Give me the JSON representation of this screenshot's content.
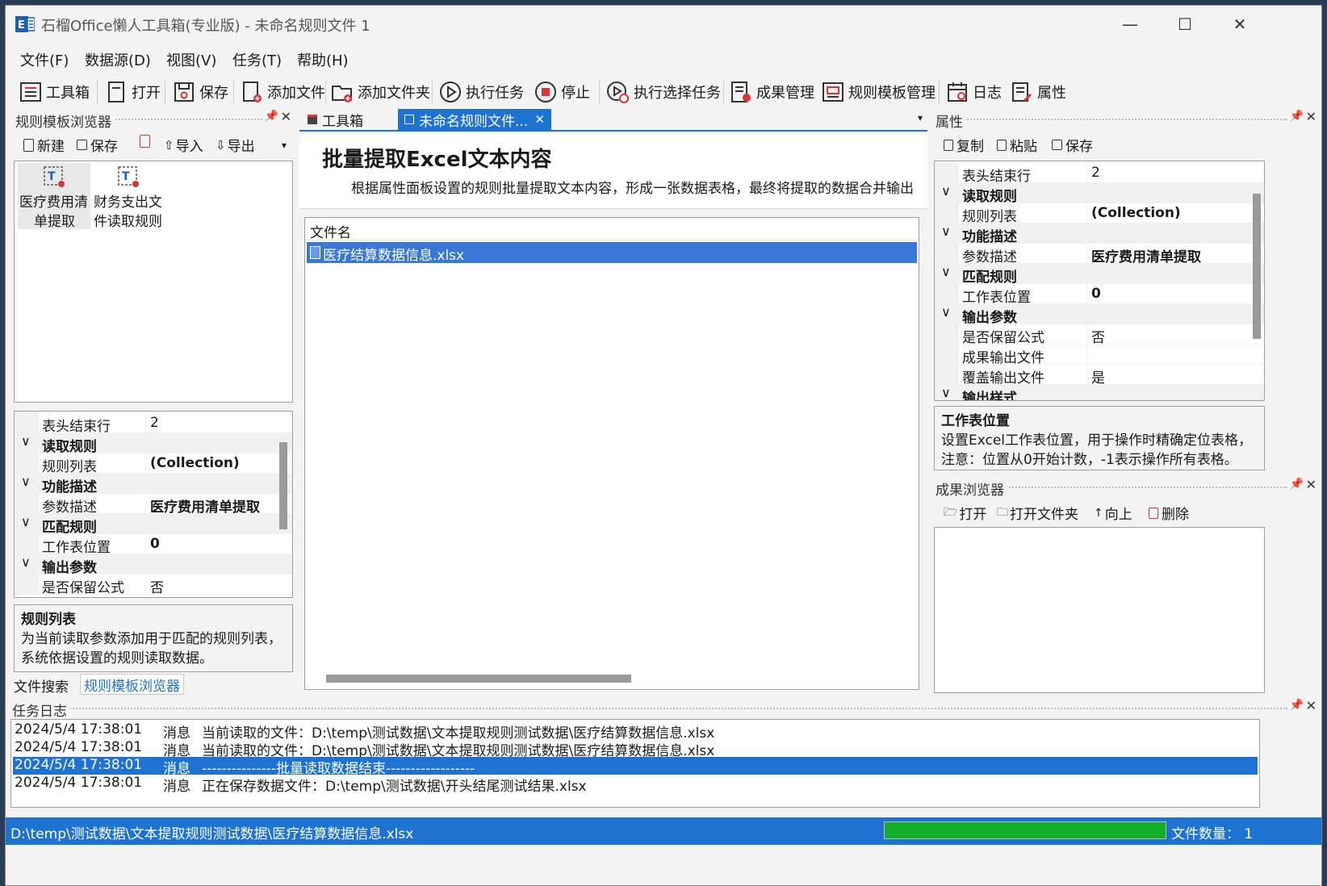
{
  "window": {
    "title": "石榴Office懒人工具箱(专业版) - 未命名规则文件 1",
    "minimize_glyph": "—",
    "maximize_glyph": "☐",
    "close_glyph": "✕"
  },
  "menu": [
    "文件(F)",
    "数据源(D)",
    "视图(V)",
    "任务(T)",
    "帮助(H)"
  ],
  "toolbar": {
    "toolbox": "工具箱",
    "open": "打开",
    "save": "保存",
    "add_file": "添加文件",
    "add_folder": "添加文件夹",
    "run_task": "执行任务",
    "stop": "停止",
    "run_selected": "执行选择任务",
    "results": "成果管理",
    "templates": "规则模板管理",
    "log": "日志",
    "properties": "属性"
  },
  "left_panel": {
    "title": "规则模板浏览器",
    "tools": {
      "new": "新建",
      "save": "保存",
      "import": "导入",
      "export": "导出"
    },
    "templates": [
      {
        "line1": "医疗费用清",
        "line2": "单提取"
      },
      {
        "line1": "财务支出文",
        "line2": "件读取规则"
      }
    ],
    "props": {
      "header_end_row_label": "表头结束行",
      "header_end_row_value": "2",
      "cat_read_rules": "读取规则",
      "rule_list_label": "规则列表",
      "rule_list_value": "(Collection)",
      "cat_func_desc": "功能描述",
      "param_desc_label": "参数描述",
      "param_desc_value": "医疗费用清单提取",
      "cat_match_rules": "匹配规则",
      "sheet_pos_label": "工作表位置",
      "sheet_pos_value": "0",
      "cat_output_params": "输出参数",
      "keep_formula_label": "是否保留公式",
      "keep_formula_value": "否"
    },
    "desc_title": "规则列表",
    "desc_line1": "为当前读取参数添加用于匹配的规则列表，",
    "desc_line2": "系统依据设置的规则读取数据。",
    "bottom_tabs": {
      "file_search": "文件搜索",
      "template_browser": "规则模板浏览器"
    }
  },
  "center": {
    "tab_toolbox": "工具箱",
    "tab_rule_file": "未命名规则文件...",
    "tab_close_glyph": "✕",
    "heading": "批量提取Excel文本内容",
    "subheading": "根据属性面板设置的规则批量提取文本内容，形成一张数据表格，最终将提取的数据合并输出",
    "file_list_header": "文件名",
    "files": [
      "医疗结算数据信息.xlsx"
    ]
  },
  "right_panel": {
    "title": "属性",
    "tools": {
      "copy": "复制",
      "paste": "粘贴",
      "save": "保存"
    },
    "props": {
      "header_end_row_label": "表头结束行",
      "header_end_row_value": "2",
      "cat_read_rules": "读取规则",
      "rule_list_label": "规则列表",
      "rule_list_value": "(Collection)",
      "cat_func_desc": "功能描述",
      "param_desc_label": "参数描述",
      "param_desc_value": "医疗费用清单提取",
      "cat_match_rules": "匹配规则",
      "sheet_pos_label": "工作表位置",
      "sheet_pos_value": "0",
      "cat_output_params": "输出参数",
      "keep_formula_label": "是否保留公式",
      "keep_formula_value": "否",
      "result_file_label": "成果输出文件",
      "result_file_value": "",
      "overwrite_label": "覆盖输出文件",
      "overwrite_value": "是",
      "cat_output_style": "输出样式"
    },
    "desc_title": "工作表位置",
    "desc_line1": "设置Excel工作表位置，用于操作时精确定位表格，",
    "desc_line2": "注意：位置从0开始计数，-1表示操作所有表格。"
  },
  "results_panel": {
    "title": "成果浏览器",
    "tools": {
      "open": "打开",
      "open_folder": "打开文件夹",
      "up": "向上",
      "delete": "删除"
    }
  },
  "log_panel": {
    "title": "任务日志",
    "rows": [
      {
        "time": "2024/5/4 17:38:01",
        "type": "消息",
        "msg": "当前读取的文件：D:\\temp\\测试数据\\文本提取规则测试数据\\医疗结算数据信息.xlsx"
      },
      {
        "time": "2024/5/4 17:38:01",
        "type": "消息",
        "msg": "当前读取的文件：D:\\temp\\测试数据\\文本提取规则测试数据\\医疗结算数据信息.xlsx"
      },
      {
        "time": "2024/5/4 17:38:01",
        "type": "消息",
        "msg": "---------------批量读取数据结束------------------"
      },
      {
        "time": "2024/5/4 17:38:01",
        "type": "消息",
        "msg": "正在保存数据文件：D:\\temp\\测试数据\\开头结尾测试结果.xlsx"
      }
    ]
  },
  "status": {
    "path": "D:\\temp\\测试数据\\文本提取规则测试数据\\医疗结算数据信息.xlsx",
    "file_count": "文件数量：  1",
    "progress": 1.0
  },
  "colors": {
    "accent": "#1e73d2",
    "selection": "#3a78d8",
    "progress": "#12b02a"
  }
}
